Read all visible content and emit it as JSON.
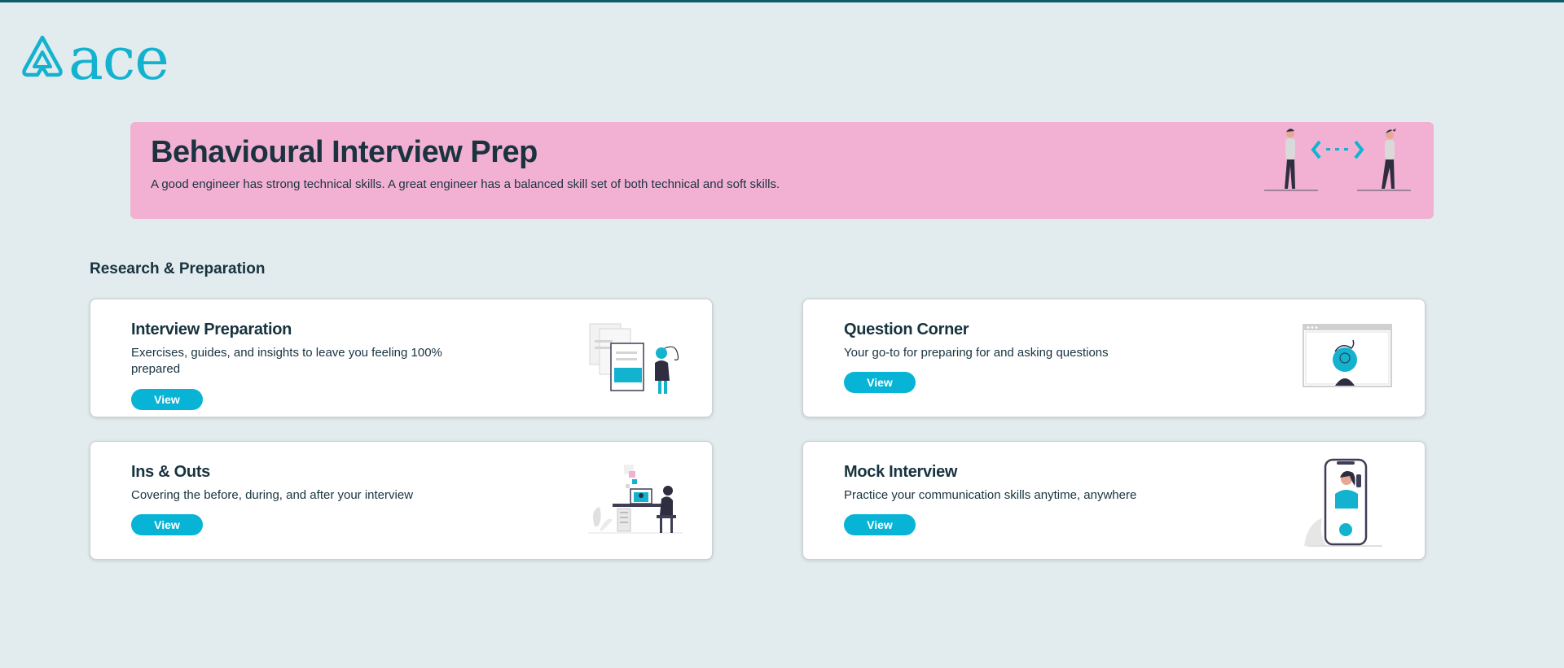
{
  "brand": {
    "name": "ace"
  },
  "banner": {
    "title": "Behavioural Interview Prep",
    "subtitle": "A good engineer has strong technical skills. A great engineer has a balanced skill set of both technical and soft skills."
  },
  "section": {
    "title": "Research & Preparation"
  },
  "cards": [
    {
      "title": "Interview Preparation",
      "description": "Exercises, guides, and insights to leave you feeling 100% prepared",
      "button": "View"
    },
    {
      "title": "Question Corner",
      "description": "Your go-to for preparing for and asking questions",
      "button": "View"
    },
    {
      "title": "Ins & Outs",
      "description": "Covering the before, during, and after your interview",
      "button": "View"
    },
    {
      "title": "Mock Interview",
      "description": "Practice your communication skills anytime, anywhere",
      "button": "View"
    }
  ],
  "colors": {
    "accent": "#07b4d6",
    "banner": "#f2b1d3",
    "background": "#e2ebed",
    "text": "#17333f",
    "topline": "#0e5a68"
  }
}
